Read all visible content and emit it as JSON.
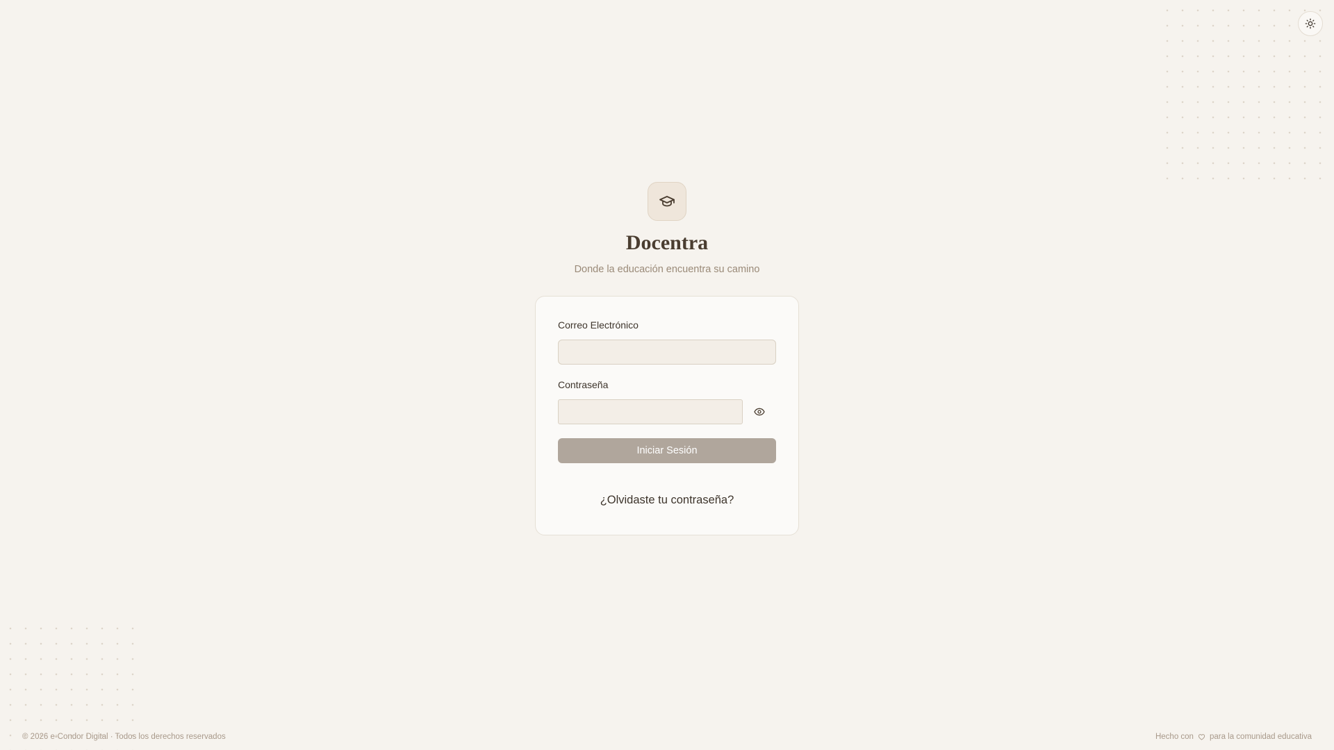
{
  "brand": {
    "logo_icon": "graduation-cap-icon",
    "title": "Docentra",
    "subtitle": "Donde la educación encuentra su camino"
  },
  "header": {
    "theme_toggle_icon": "sun-icon"
  },
  "login_form": {
    "email_label": "Correo Electrónico",
    "email_value": "",
    "password_label": "Contraseña",
    "password_value": "",
    "show_password_icon": "eye-icon",
    "submit_label": "Iniciar Sesión",
    "forgot_password_label": "¿Olvidaste tu contraseña?"
  },
  "footer": {
    "copyright": "© 2026 e-Condor Digital · Todos los derechos reservados",
    "made_with_prefix": "Hecho con",
    "heart_icon": "heart-icon",
    "made_with_suffix": "para la comunidad educativa"
  },
  "colors": {
    "background": "#f6f3ee",
    "card": "#fbfaf8",
    "button": "#b0a69c",
    "title": "#4a3d30",
    "muted_text": "#9a8a78"
  }
}
